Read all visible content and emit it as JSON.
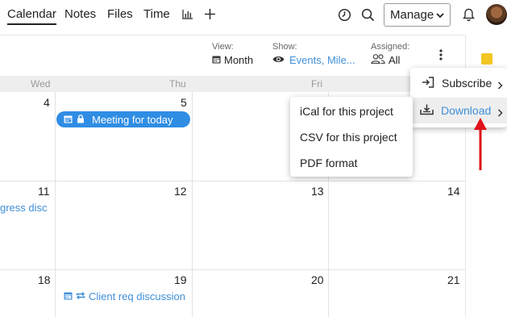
{
  "nav": {
    "tabs": [
      {
        "label": "Calendar",
        "active": true
      },
      {
        "label": "Notes"
      },
      {
        "label": "Files"
      },
      {
        "label": "Time"
      }
    ],
    "chart_icon": "bar-chart-icon",
    "add_icon": "plus-icon",
    "manage_label": "Manage"
  },
  "filters": {
    "view_label": "View:",
    "view_value": "Month",
    "show_label": "Show:",
    "show_value": "Events, Mile...",
    "assigned_label": "Assigned:",
    "assigned_value": "All"
  },
  "calendar": {
    "day_names": [
      "Wed",
      "Thu",
      "Fri"
    ],
    "week1": [
      "4",
      "5",
      "",
      ""
    ],
    "week2": [
      "11",
      "12",
      "13",
      "14"
    ],
    "week3": [
      "18",
      "19",
      "20",
      "21"
    ],
    "events": {
      "meeting": "Meeting for today",
      "progress": "gress disc",
      "client": "Client req discussion"
    }
  },
  "menu": {
    "subscribe": "Subscribe",
    "download": "Download",
    "download_options": [
      "iCal for this project",
      "CSV for this project",
      "PDF format"
    ]
  },
  "colors": {
    "accent": "#2f8de4",
    "link": "#3f8fd8",
    "annotation_arrow": "#e0121a"
  }
}
